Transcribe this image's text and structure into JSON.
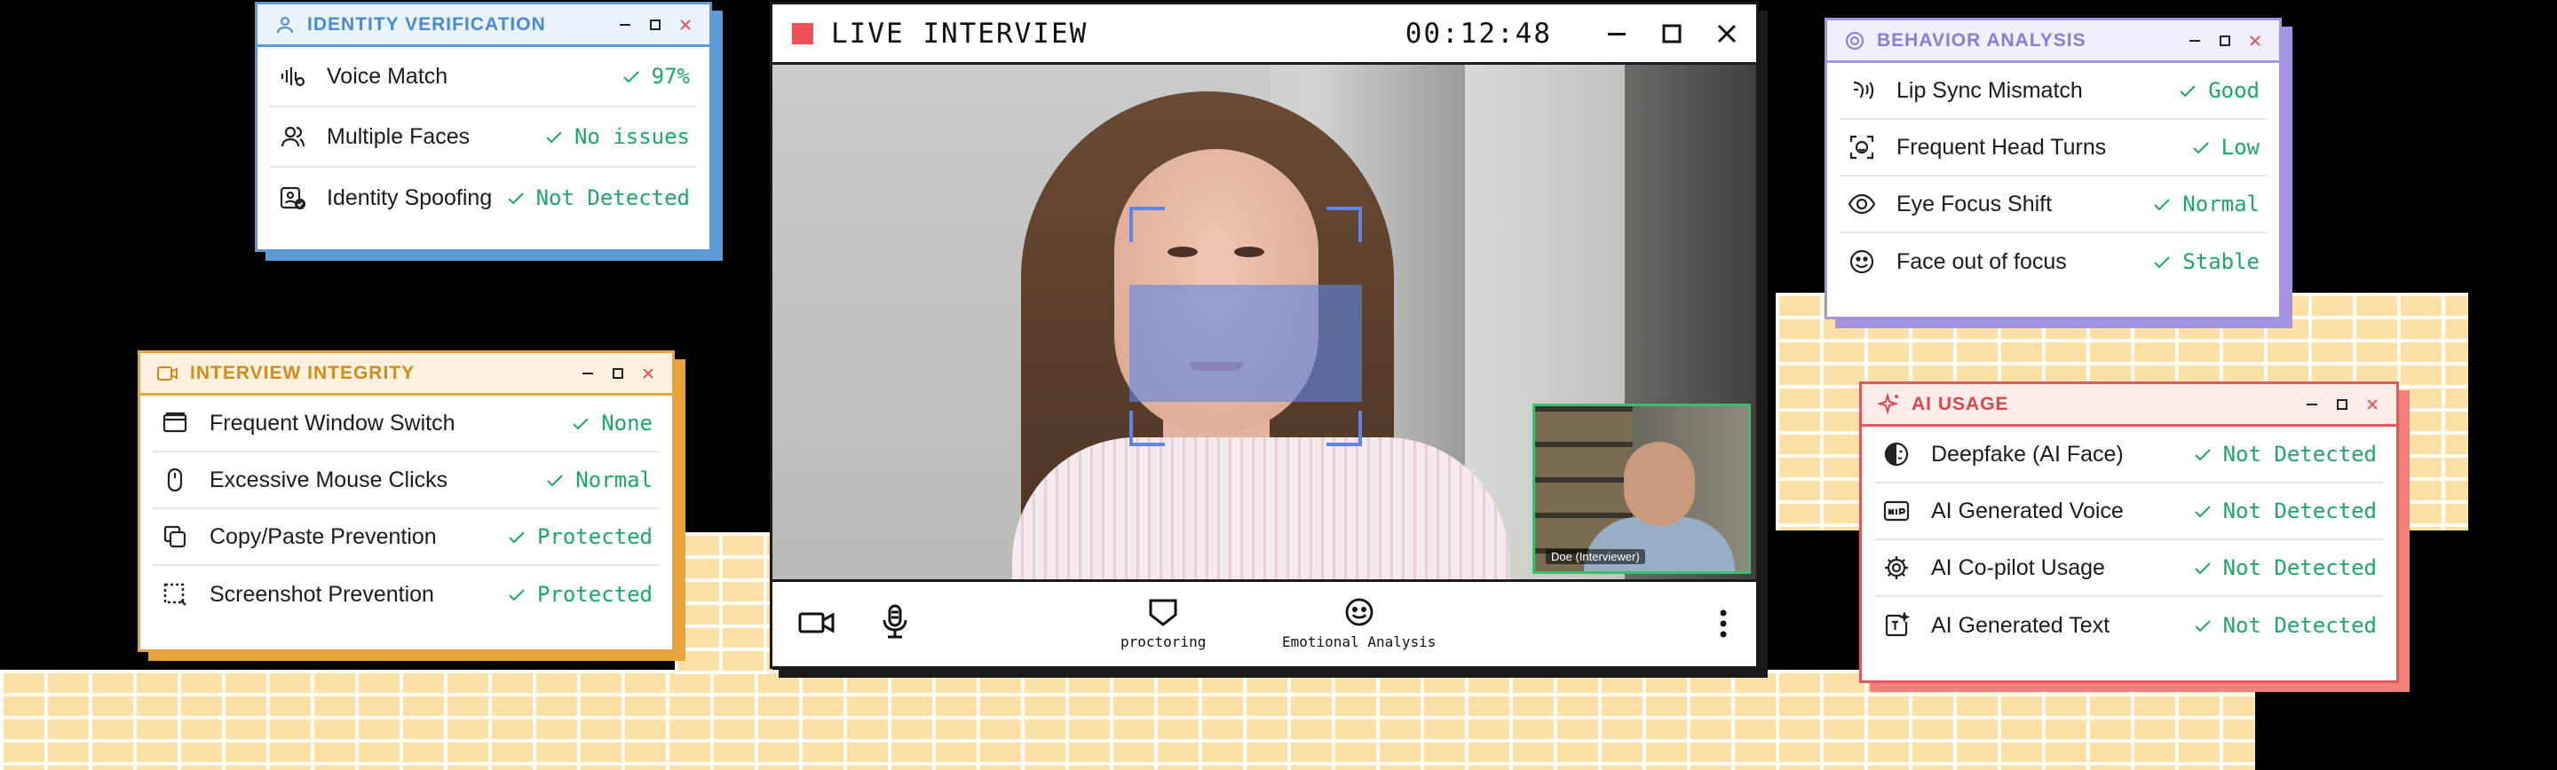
{
  "colors": {
    "identity": "#5b9bd8",
    "integrity": "#e8a33a",
    "behavior": "#a493e0",
    "ai": "#e3575a",
    "ok": "#1fa56a",
    "face_scan": "#5f86e6",
    "record": "#f0505a"
  },
  "identity": {
    "title": "IDENTITY VERIFICATION",
    "icon": "user-icon",
    "rows": [
      {
        "label": "Voice Match",
        "value": "97%",
        "icon": "voice-wave-icon"
      },
      {
        "label": "Multiple Faces",
        "value": "No issues",
        "icon": "users-icon"
      },
      {
        "label": "Identity Spoofing",
        "value": "Not Detected",
        "icon": "id-card-check-icon"
      }
    ]
  },
  "integrity": {
    "title": "INTERVIEW INTEGRITY",
    "icon": "video-icon",
    "rows": [
      {
        "label": "Frequent Window Switch",
        "value": "None",
        "icon": "window-icon"
      },
      {
        "label": "Excessive Mouse Clicks",
        "value": "Normal",
        "icon": "mouse-icon"
      },
      {
        "label": "Copy/Paste Prevention",
        "value": "Protected",
        "icon": "copy-icon"
      },
      {
        "label": "Screenshot Prevention",
        "value": "Protected",
        "icon": "screenshot-icon"
      }
    ]
  },
  "live": {
    "title": "LIVE INTERVIEW",
    "timer": "00:12:48",
    "pip_label": "Doe (Interviewer)",
    "toolbar": {
      "proctoring": "proctoring",
      "emotional": "Emotional Analysis"
    }
  },
  "behavior": {
    "title": "BEHAVIOR ANALYSIS",
    "icon": "behavior-icon",
    "rows": [
      {
        "label": "Lip Sync Mismatch",
        "value": "Good",
        "icon": "lip-sync-icon"
      },
      {
        "label": "Frequent Head Turns",
        "value": "Low",
        "icon": "face-scan-icon"
      },
      {
        "label": "Eye Focus Shift",
        "value": "Normal",
        "icon": "eye-icon"
      },
      {
        "label": "Face out of focus",
        "value": "Stable",
        "icon": "smile-icon"
      }
    ]
  },
  "ai": {
    "title": "AI USAGE",
    "icon": "sparkle-icon",
    "rows": [
      {
        "label": "Deepfake (AI Face)",
        "value": "Not Detected",
        "icon": "deepfake-icon"
      },
      {
        "label": "AI Generated Voice",
        "value": "Not Detected",
        "icon": "ai-voice-icon"
      },
      {
        "label": "AI Co-pilot Usage",
        "value": "Not Detected",
        "icon": "gear-icon"
      },
      {
        "label": "AI Generated Text",
        "value": "Not Detected",
        "icon": "ai-text-icon"
      }
    ]
  }
}
